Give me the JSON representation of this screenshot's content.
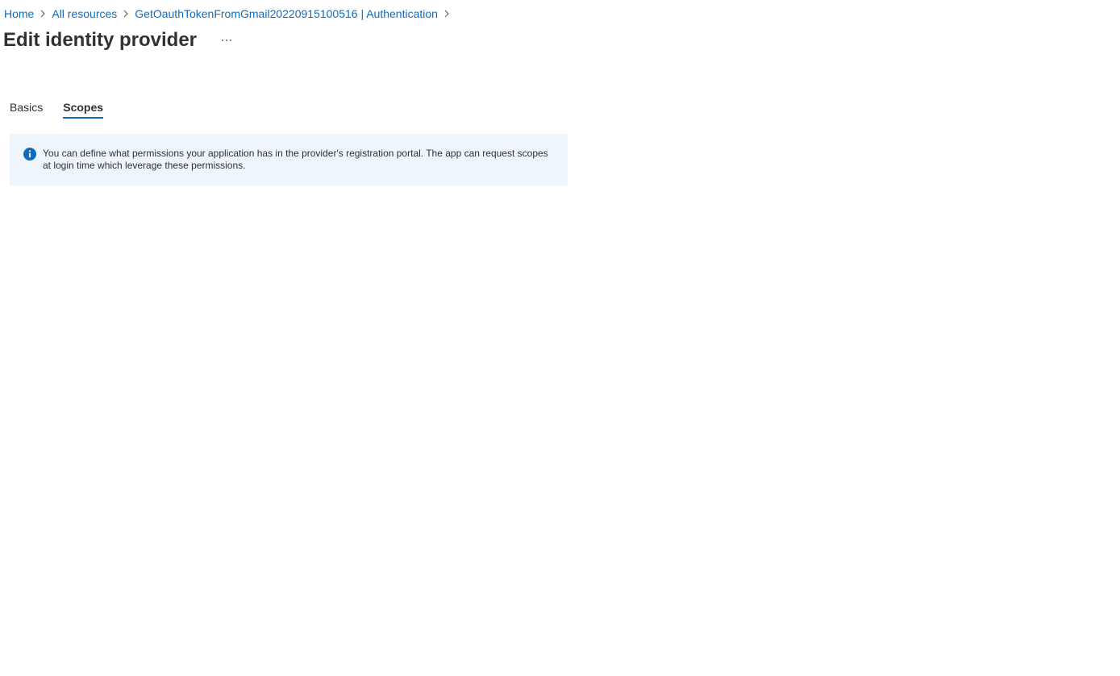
{
  "breadcrumb": {
    "items": [
      {
        "label": "Home"
      },
      {
        "label": "All resources"
      },
      {
        "label": "GetOauthTokenFromGmail20220915100516 | Authentication"
      }
    ]
  },
  "header": {
    "title": "Edit identity provider",
    "more_label": "..."
  },
  "tabs": [
    {
      "label": "Basics",
      "active": false
    },
    {
      "label": "Scopes",
      "active": true
    }
  ],
  "info": {
    "text": "You can define what permissions your application has in the provider's registration portal. The app can request scopes at login time which leverage these permissions.",
    "icon": "info-icon"
  },
  "colors": {
    "link": "#0f6cbd",
    "info_bg": "#eef5fd",
    "info_icon": "#0f6cbd",
    "text": "#323130"
  }
}
